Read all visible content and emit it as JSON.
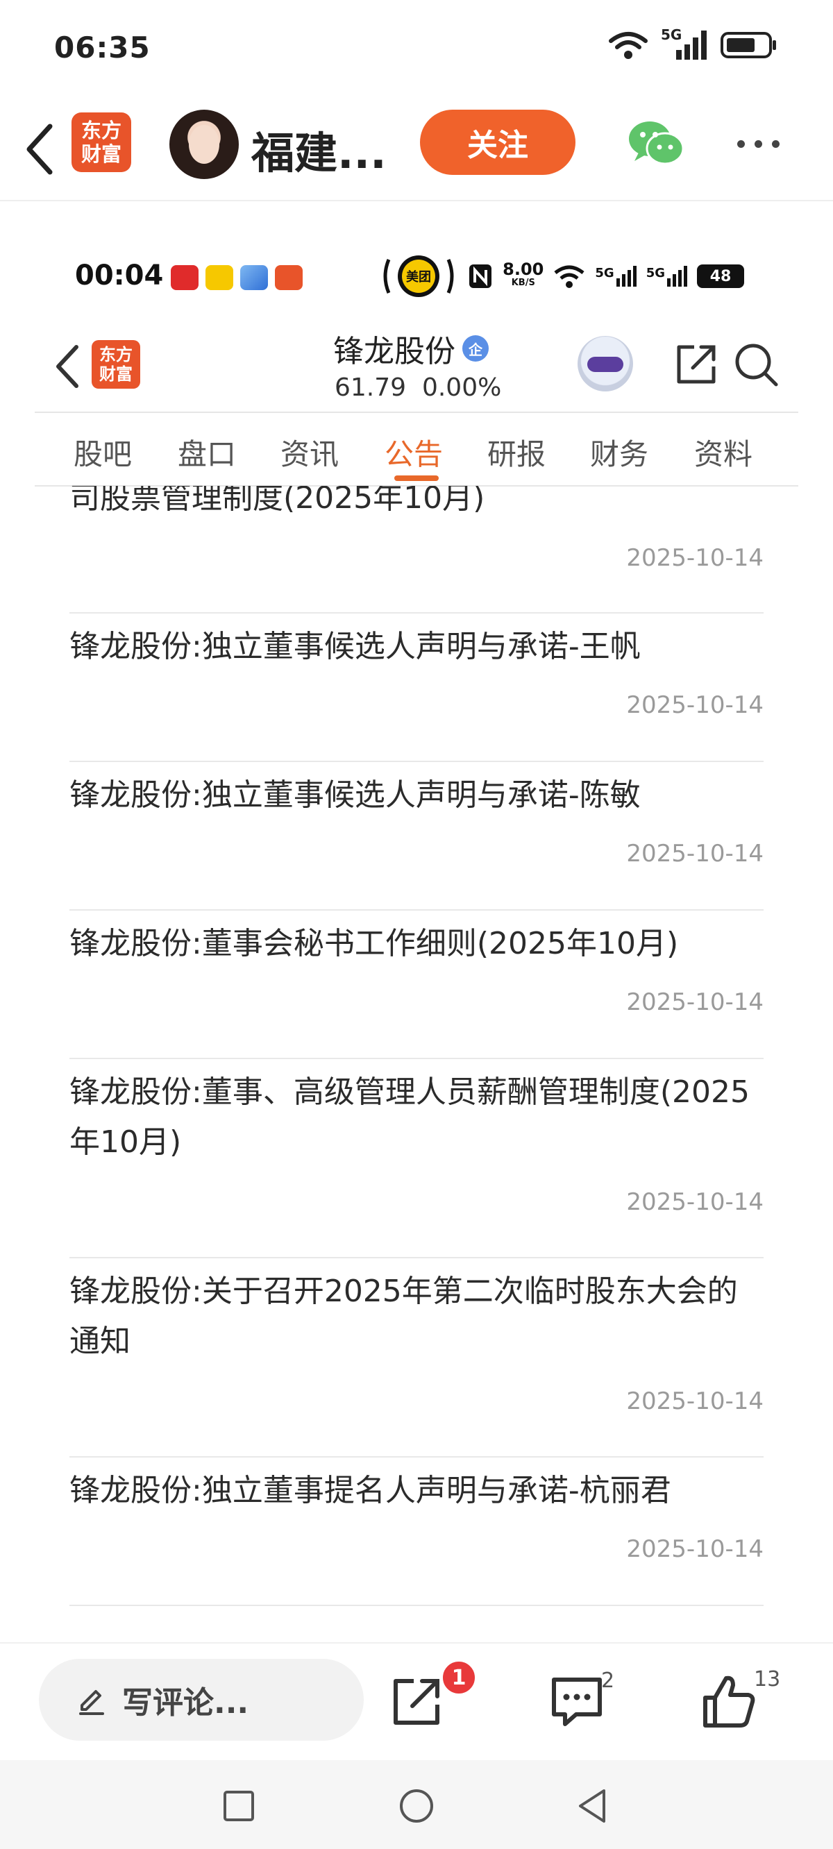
{
  "status_bar": {
    "time": "06:35",
    "network": "5G"
  },
  "header": {
    "logo_text": [
      "东方",
      "财富"
    ],
    "author_name": "福建...",
    "follow_label": "关注"
  },
  "inner_status": {
    "time": "00:04",
    "meituan_label": "美团",
    "speed_value": "8.00",
    "speed_unit": "KB/S",
    "sim1": "5G",
    "sim2": "5G",
    "battery": "48"
  },
  "stock": {
    "logo_text": [
      "东方",
      "财富"
    ],
    "name": "锋龙股份",
    "badge": "企",
    "price": "61.79",
    "change": "0.00%"
  },
  "tabs": [
    {
      "label": "股吧",
      "active": false
    },
    {
      "label": "盘口",
      "active": false
    },
    {
      "label": "资讯",
      "active": false
    },
    {
      "label": "公告",
      "active": true
    },
    {
      "label": "研报",
      "active": false
    },
    {
      "label": "财务",
      "active": false
    },
    {
      "label": "资料",
      "active": false
    }
  ],
  "notices": [
    {
      "title": "司股票管理制度(2025年10月)",
      "date": "2025-10-14"
    },
    {
      "title": "锋龙股份:独立董事候选人声明与承诺-王帆",
      "date": "2025-10-14"
    },
    {
      "title": "锋龙股份:独立董事候选人声明与承诺-陈敏",
      "date": "2025-10-14"
    },
    {
      "title": "锋龙股份:董事会秘书工作细则(2025年10月)",
      "date": "2025-10-14"
    },
    {
      "title": "锋龙股份:董事、高级管理人员薪酬管理制度(2025年10月)",
      "date": "2025-10-14"
    },
    {
      "title": "锋龙股份:关于召开2025年第二次临时股东大会的通知",
      "date": "2025-10-14"
    },
    {
      "title": "锋龙股份:独立董事提名人声明与承诺-杭丽君",
      "date": "2025-10-14"
    }
  ],
  "action_bar": {
    "comment_placeholder": "写评论...",
    "share_badge": "1",
    "comment_count": "2",
    "like_count": "13"
  },
  "colors": {
    "accent": "#e8682a",
    "follow": "#f0622b",
    "badge": "#e8393a"
  }
}
